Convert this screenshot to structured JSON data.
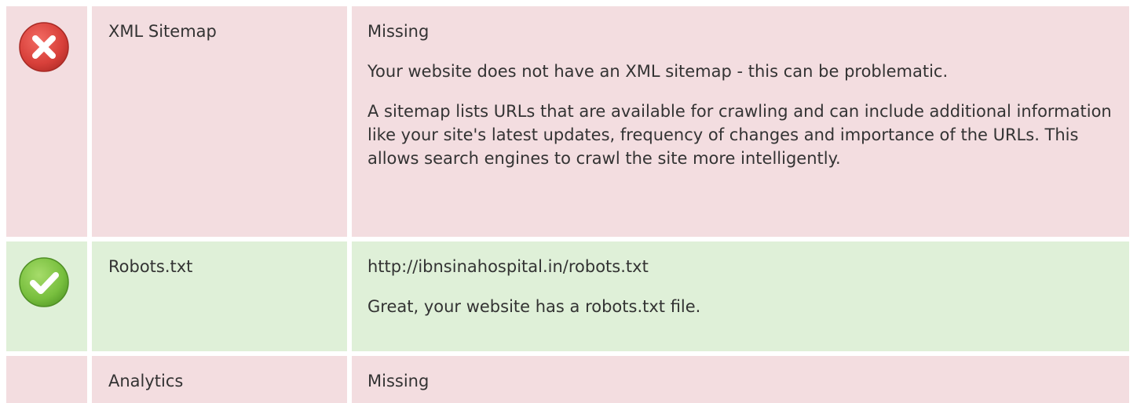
{
  "rows": [
    {
      "status": "fail",
      "icon": "error-x-icon",
      "label": "XML Sitemap",
      "value": "Missing",
      "paragraphs": [
        "Your website does not have an XML sitemap - this can be problematic.",
        "A sitemap lists URLs that are available for crawling and can include additional information like your site's latest updates, frequency of changes and importance of the URLs. This allows search engines to crawl the site more intelligently."
      ]
    },
    {
      "status": "pass",
      "icon": "success-check-icon",
      "label": "Robots.txt",
      "value": "http://ibnsinahospital.in/robots.txt",
      "paragraphs": [
        "Great, your website has a robots.txt file."
      ]
    },
    {
      "status": "fail",
      "icon": "",
      "label": "Analytics",
      "value": "Missing",
      "paragraphs": []
    }
  ],
  "colors": {
    "fail_background": "#f3dde0",
    "pass_background": "#dff0d8",
    "fail_icon": "#d9534f",
    "pass_icon": "#7cc243"
  }
}
